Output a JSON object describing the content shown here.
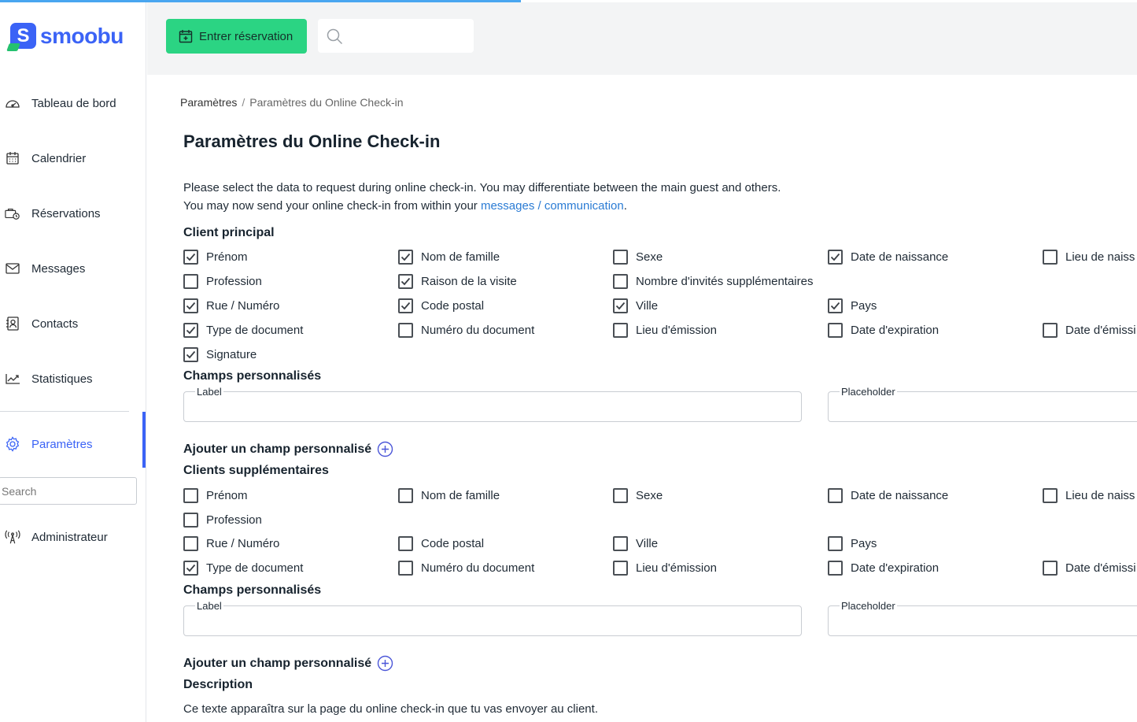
{
  "brand": {
    "name": "smoobu",
    "mark": "S"
  },
  "sidebar": {
    "items": [
      {
        "label": "Tableau de bord",
        "icon": "dashboard-icon"
      },
      {
        "label": "Calendrier",
        "icon": "calendar-icon"
      },
      {
        "label": "Réservations",
        "icon": "reservations-icon"
      },
      {
        "label": "Messages",
        "icon": "mail-icon"
      },
      {
        "label": "Contacts",
        "icon": "contacts-icon"
      },
      {
        "label": "Statistiques",
        "icon": "chart-icon"
      },
      {
        "label": "Paramètres",
        "icon": "gear-icon"
      },
      {
        "label": "Administrateur",
        "icon": "admin-icon"
      }
    ],
    "search_placeholder": "Search"
  },
  "topbar": {
    "new_booking_label": "Entrer réservation",
    "search_placeholder": ""
  },
  "breadcrumb": {
    "root": "Paramètres",
    "separator": "/",
    "current": "Paramètres du Online Check-in"
  },
  "page": {
    "title": "Paramètres du Online Check-in",
    "intro_line1": "Please select the data to request during online check-in. You may differentiate between the main guest and others.",
    "intro_line2_pre": "You may now send your online check-in from within your ",
    "intro_link": "messages / communication",
    "intro_line2_post": "."
  },
  "main_guest": {
    "heading": "Client principal",
    "fields": [
      {
        "label": "Prénom",
        "checked": true
      },
      {
        "label": "Nom de famille",
        "checked": true
      },
      {
        "label": "Sexe",
        "checked": false
      },
      {
        "label": "Date de naissance",
        "checked": true
      },
      {
        "label": "Lieu de naiss",
        "checked": false
      },
      {
        "label": "Profession",
        "checked": false
      },
      {
        "label": "Raison de la visite",
        "checked": true
      },
      {
        "label": "Nombre d'invités supplémentaires",
        "checked": false
      },
      {
        "label": "Rue / Numéro",
        "checked": true
      },
      {
        "label": "Code postal",
        "checked": true
      },
      {
        "label": "Ville",
        "checked": true
      },
      {
        "label": "Pays",
        "checked": true
      },
      {
        "label": "Type de document",
        "checked": true
      },
      {
        "label": "Numéro du document",
        "checked": false
      },
      {
        "label": "Lieu d'émission",
        "checked": false
      },
      {
        "label": "Date d'expiration",
        "checked": false
      },
      {
        "label": "Date d'émissi",
        "checked": false
      },
      {
        "label": "Signature",
        "checked": true
      }
    ],
    "custom_heading": "Champs personnalisés",
    "label_legend": "Label",
    "placeholder_legend": "Placeholder",
    "add_custom": "Ajouter un champ personnalisé"
  },
  "additional_guests": {
    "heading": "Clients supplémentaires",
    "fields": [
      {
        "label": "Prénom",
        "checked": false
      },
      {
        "label": "Nom de famille",
        "checked": false
      },
      {
        "label": "Sexe",
        "checked": false
      },
      {
        "label": "Date de naissance",
        "checked": false
      },
      {
        "label": "Lieu de naiss",
        "checked": false
      },
      {
        "label": "Profession",
        "checked": false
      },
      {
        "label": "Rue / Numéro",
        "checked": false
      },
      {
        "label": "Code postal",
        "checked": false
      },
      {
        "label": "Ville",
        "checked": false
      },
      {
        "label": "Pays",
        "checked": false
      },
      {
        "label": "Type de document",
        "checked": true
      },
      {
        "label": "Numéro du document",
        "checked": false
      },
      {
        "label": "Lieu d'émission",
        "checked": false
      },
      {
        "label": "Date d'expiration",
        "checked": false
      },
      {
        "label": "Date d'émissi",
        "checked": false
      }
    ],
    "custom_heading": "Champs personnalisés",
    "label_legend": "Label",
    "placeholder_legend": "Placeholder",
    "add_custom": "Ajouter un champ personnalisé"
  },
  "description": {
    "heading": "Description",
    "text": "Ce texte apparaîtra sur la page du online check-in que tu vas envoyer au client."
  },
  "colors": {
    "accent": "#3b63f6",
    "green": "#2bd483",
    "link": "#2a7bd4"
  }
}
